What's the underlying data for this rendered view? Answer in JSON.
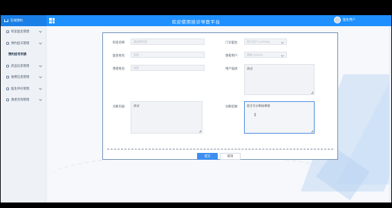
{
  "header": {
    "brand": "在线预约",
    "title": "欢迎使用挂诊导医平台",
    "user_name": "医生用户"
  },
  "sidebar": {
    "items": [
      {
        "label": "科室医生管理",
        "active": false
      },
      {
        "label": "预约挂号管理",
        "active": false
      },
      {
        "label": "预约挂号列表",
        "active": true
      },
      {
        "label": "药品信息管理",
        "active": false
      },
      {
        "label": "收费信息管理",
        "active": false
      },
      {
        "label": "医生评价管理",
        "active": false
      },
      {
        "label": "患者咨询管理",
        "active": false
      }
    ]
  },
  "form": {
    "fields": [
      {
        "label": "科室名称:",
        "value": "请选择科室"
      },
      {
        "label": "门诊医生:",
        "value": "医生用户 (123456)"
      },
      {
        "label": "医生姓名:",
        "value": "张医"
      },
      {
        "label": "患者用户:",
        "value": "患者 (00000)"
      },
      {
        "label": "患者姓名:",
        "value": "张医"
      }
    ],
    "symptom": {
      "label": "用户描述:",
      "value": "测试"
    },
    "diagnosis": {
      "label": "诊断内容:",
      "value": "测试"
    },
    "treatment": {
      "label": "诊断结果:",
      "value": "医生写诊断结果哦"
    },
    "submit_label": "提交",
    "cancel_label": "取消"
  }
}
